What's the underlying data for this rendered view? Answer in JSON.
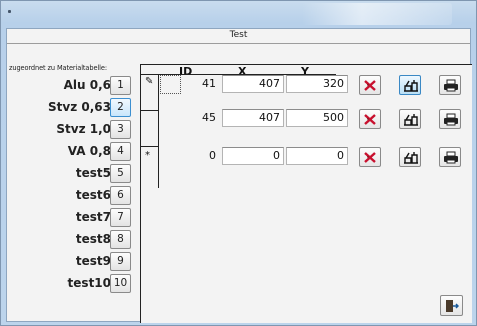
{
  "window": {
    "title": "Test"
  },
  "materials": {
    "label": "zugeordnet zu Materialtabelle:",
    "items": [
      {
        "name": "Alu 0,6",
        "button": "1"
      },
      {
        "name": "Stvz 0,63",
        "button": "2"
      },
      {
        "name": "Stvz 1,0",
        "button": "3"
      },
      {
        "name": "VA 0,8",
        "button": "4"
      },
      {
        "name": "test5",
        "button": "5"
      },
      {
        "name": "test6",
        "button": "6"
      },
      {
        "name": "test7",
        "button": "7"
      },
      {
        "name": "test8",
        "button": "8"
      },
      {
        "name": "test9",
        "button": "9"
      },
      {
        "name": "test10",
        "button": "10"
      }
    ],
    "selected_button": "2"
  },
  "grid": {
    "headers": {
      "id": "ID",
      "x": "X",
      "y": "Y"
    },
    "selector_glyphs": [
      "✎",
      "",
      "*"
    ],
    "rows": [
      {
        "id": "41",
        "x": "407",
        "y": "320"
      },
      {
        "id": "45",
        "x": "407",
        "y": "500"
      },
      {
        "id": "0",
        "x": "0",
        "y": "0"
      }
    ],
    "row_icons": [
      "delete-icon",
      "machine-icon",
      "print-icon"
    ]
  },
  "colors": {
    "accent": "#3c8fd0",
    "delete_red": "#c8102e",
    "panel_bg": "#f3f3f3"
  },
  "footer": {
    "exit_icon": "exit-door-icon"
  }
}
